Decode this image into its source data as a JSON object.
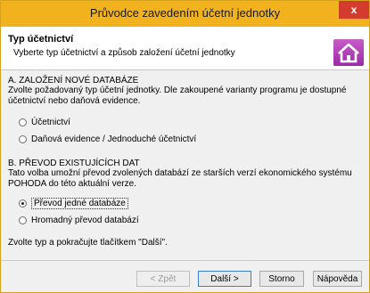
{
  "window": {
    "title": "Průvodce zavedením účetní jednotky",
    "close_label": "x"
  },
  "header": {
    "title": "Typ účetnictví",
    "subtitle": "Vyberte typ účetnictví a způsob založení účetní jednotky"
  },
  "section_a": {
    "title": "A. ZALOŽENÍ NOVÉ DATABÁZE",
    "description_line1": "Zvolte požadovaný typ účetní jednotky. Dle zakoupené varianty programu je dostupné",
    "description_line2": "účetnictví nebo daňová evidence.",
    "options": [
      {
        "label": "Účetnictví",
        "checked": false
      },
      {
        "label": "Daňová evidence / Jednoduché účetnictví",
        "checked": false
      }
    ]
  },
  "section_b": {
    "title": "B. PŘEVOD EXISTUJÍCÍCH DAT",
    "description_line1": "Tato volba umožní převod zvolených databází ze starších verzí ekonomického systému",
    "description_line2": "POHODA do této aktuální verze.",
    "options": [
      {
        "label": "Převod jedné databáze",
        "checked": true
      },
      {
        "label": "Hromadný převod databází",
        "checked": false
      }
    ]
  },
  "note": "Zvolte typ a pokračujte tlačítkem \"Další\".",
  "buttons": {
    "back": "< Zpět",
    "next": "Další >",
    "cancel": "Storno",
    "help": "Nápověda"
  },
  "icons": {
    "header": "home-icon"
  }
}
